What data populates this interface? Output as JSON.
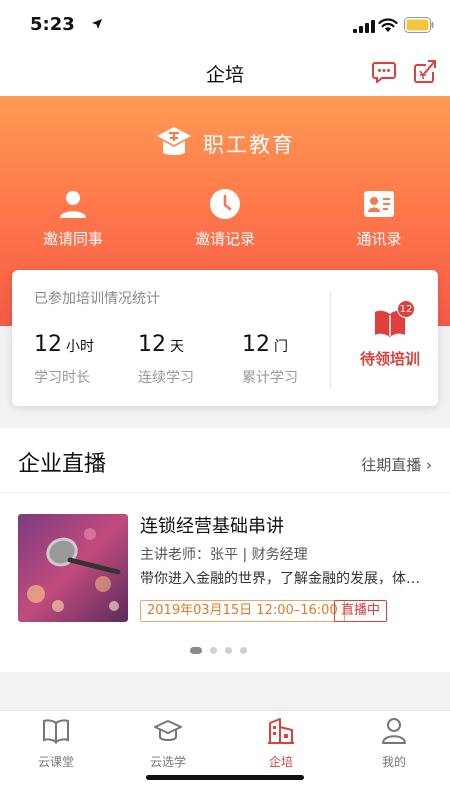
{
  "status_bar": {
    "time": "5:23"
  },
  "nav": {
    "title": "企培"
  },
  "hero": {
    "brand_name": "职工教育",
    "quick_actions": [
      {
        "label": "邀请同事",
        "icon": "person-icon"
      },
      {
        "label": "邀请记录",
        "icon": "clock-icon"
      },
      {
        "label": "通讯录",
        "icon": "contact-card-icon"
      }
    ]
  },
  "stats": {
    "caption": "已参加培训情况统计",
    "items": [
      {
        "value": "12",
        "unit": "小时",
        "label": "学习时长"
      },
      {
        "value": "12",
        "unit": "天",
        "label": "连续学习"
      },
      {
        "value": "12",
        "unit": "门",
        "label": "累计学习"
      }
    ],
    "pending": {
      "label": "待领培训",
      "badge": "12"
    }
  },
  "live": {
    "title": "企业直播",
    "more_label": "往期直播 ›",
    "course": {
      "title": "连锁经营基础串讲",
      "teacher": "主讲老师：张平 | 财务经理",
      "description": "带你进入金融的世界，了解金融的发展，体会…",
      "time": "2019年03月15日 12:00–16:00",
      "status": "直播中"
    },
    "carousel": {
      "count": 4,
      "active_index": 0
    }
  },
  "tab_bar": {
    "items": [
      {
        "label": "云课堂",
        "icon": "book-icon"
      },
      {
        "label": "云选学",
        "icon": "graduation-cap-icon"
      },
      {
        "label": "企培",
        "icon": "building-icon"
      },
      {
        "label": "我的",
        "icon": "user-icon"
      }
    ],
    "active_index": 2
  },
  "colors": {
    "accent": "#e0403c",
    "hero_gradient_top": "#ff9a55",
    "hero_gradient_bottom": "#f55a48",
    "time_tag": "#e37a28"
  }
}
